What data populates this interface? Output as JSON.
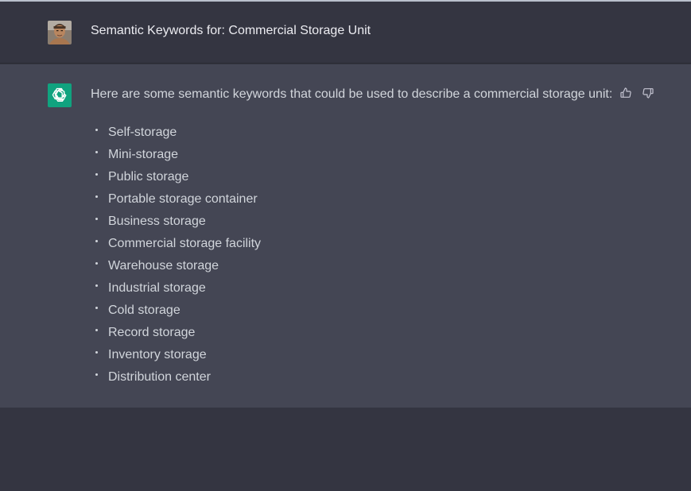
{
  "user_message": {
    "avatar": "user-photo-avatar",
    "text": "Semantic Keywords for: Commercial Storage Unit"
  },
  "assistant_message": {
    "avatar": "openai-logo-icon",
    "intro": "Here are some semantic keywords that could be used to describe a commercial storage unit:",
    "keywords": [
      "Self-storage",
      "Mini-storage",
      "Public storage",
      "Portable storage container",
      "Business storage",
      "Commercial storage facility",
      "Warehouse storage",
      "Industrial storage",
      "Cold storage",
      "Record storage",
      "Inventory storage",
      "Distribution center"
    ],
    "feedback_icons": [
      "thumbs-up-icon",
      "thumbs-down-icon"
    ]
  },
  "colors": {
    "background": "#343541",
    "assistant_background": "#444654",
    "accent": "#10a37f",
    "text": "#ececf1"
  }
}
